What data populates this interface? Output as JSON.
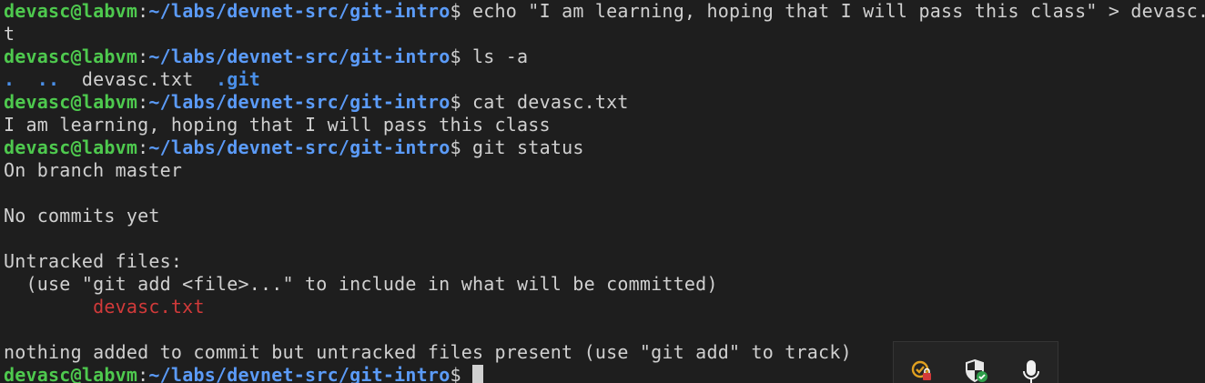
{
  "prompt": {
    "user": "devasc@labvm",
    "sep": ":",
    "path": "~/labs/devnet-src/git-intro",
    "end": "$ "
  },
  "lines": {
    "cmd1": "echo \"I am learning, hoping that I will pass this class\" > devasc.tx",
    "cmd1_wrap": "t",
    "cmd2": "ls -a",
    "ls_dot": ".",
    "ls_dotdot": "..",
    "ls_file": "devasc.txt",
    "ls_git": ".git",
    "cmd3": "cat devasc.txt",
    "cat_out": "I am learning, hoping that I will pass this class",
    "cmd4": "git status",
    "status_branch": "On branch master",
    "status_commits": "No commits yet",
    "status_untracked_header": "Untracked files:",
    "status_hint": "  (use \"git add <file>...\" to include in what will be committed)",
    "status_file": "devasc.txt",
    "status_summary": "nothing added to commit but untracked files present (use \"git add\" to track)"
  },
  "tray": {
    "icons": [
      "network-locked-icon",
      "security-shield-icon",
      "microphone-icon"
    ]
  },
  "colors": {
    "background": "#1e1e1e",
    "user": "#4ec94e",
    "path": "#5b9bf8",
    "text": "#d0d0d0",
    "untracked": "#d23a3a"
  }
}
